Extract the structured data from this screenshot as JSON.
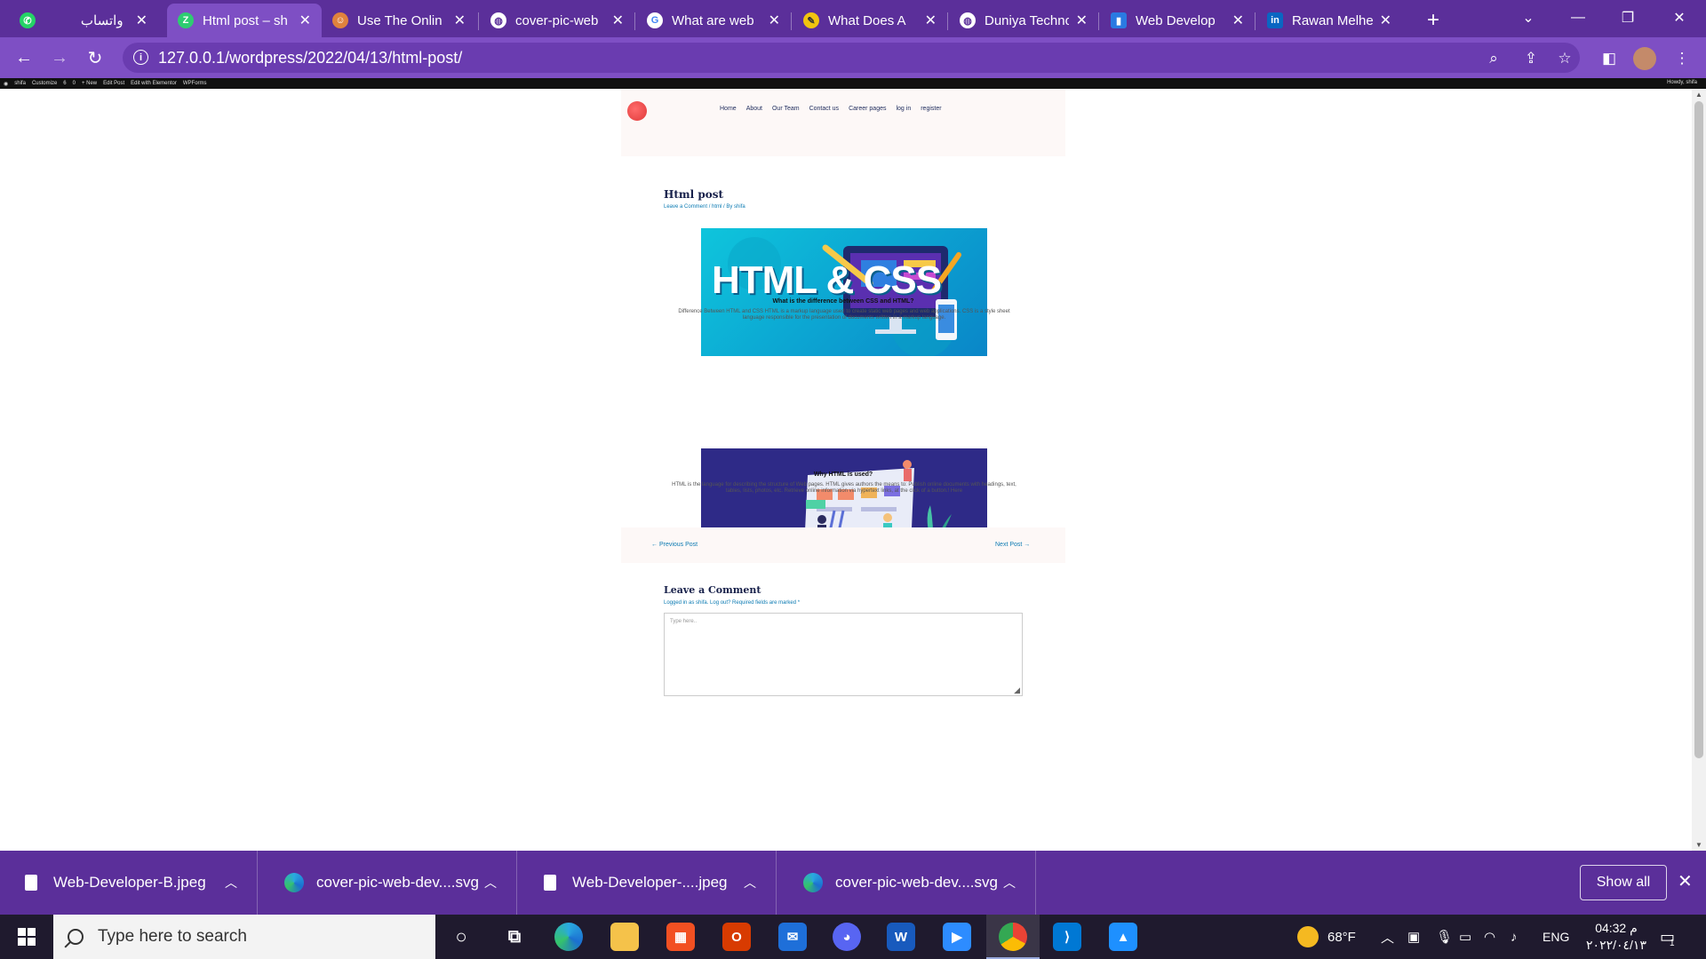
{
  "browser": {
    "tabs": [
      {
        "title": "واتساب",
        "favicon": "whatsapp-icon",
        "color": "#25d366"
      },
      {
        "title": "Html post – sh",
        "favicon": "site-icon",
        "color": "#2ecc71",
        "active": true
      },
      {
        "title": "Use The Onlin",
        "favicon": "person-icon",
        "color": "#e0823d"
      },
      {
        "title": "cover-pic-web",
        "favicon": "globe-icon",
        "color": "#ffffff"
      },
      {
        "title": "What are web",
        "favicon": "google-icon",
        "color": "#ffffff"
      },
      {
        "title": "What Does A",
        "favicon": "pen-icon",
        "color": "#f1c40f"
      },
      {
        "title": "Duniya Techno",
        "favicon": "globe-icon",
        "color": "#ffffff"
      },
      {
        "title": "Web Develop",
        "favicon": "bookmark-icon",
        "color": "#2a7ae2"
      },
      {
        "title": "Rawan Melhe",
        "favicon": "linkedin-icon",
        "color": "#0a66c2"
      }
    ],
    "new_tab": "+",
    "url": "127.0.0.1/wordpress/2022/04/13/html-post/"
  },
  "wp_admin_bar": {
    "items": [
      "shifa",
      "Customize",
      "6",
      "0",
      "+ New",
      "Edit Post",
      "Edit with Elementor",
      "WPForms"
    ],
    "greeting": "Howdy, shifa"
  },
  "site": {
    "menu": [
      "Home",
      "About",
      "Our Team",
      "Contact us",
      "Career pages",
      "log in",
      "register"
    ],
    "post_title": "Html post",
    "post_meta": "Leave a Comment / html / By shifa",
    "section1_heading": "What is the difference between CSS and HTML?",
    "section1_text": "Difference Between HTML and CSS HTML is a markup language used to create static web pages and web applications. CSS is a style sheet language responsible for the presentation of documents written in a markup language.",
    "hero1_text": "HTML & CSS",
    "section2_heading": "Why HTML is used?",
    "section2_text": "HTML is the language for describing the structure of Web pages. HTML gives authors the means to: Publish online documents with headings, text, tables, lists, photos, etc. Retrieve online information via hypertext links, at the click of a button.! Here",
    "prev_post": "← Previous Post",
    "next_post": "Next Post →",
    "comment_title": "Leave a Comment",
    "comment_note": "Logged in as shifa. Log out? Required fields are marked *",
    "comment_placeholder": "Type here.."
  },
  "downloads": {
    "items": [
      {
        "name": "Web-Developer-B.jpeg",
        "icon": "file-icon"
      },
      {
        "name": "cover-pic-web-dev....svg",
        "icon": "edge-icon"
      },
      {
        "name": "Web-Developer-....jpeg",
        "icon": "file-icon"
      },
      {
        "name": "cover-pic-web-dev....svg",
        "icon": "edge-icon"
      }
    ],
    "show_all": "Show all"
  },
  "taskbar": {
    "search_placeholder": "Type here to search",
    "weather": "68°F",
    "language": "ENG",
    "time": "04:32 م",
    "date": "٢٠٢٢/٠٤/١٣",
    "notification_count": "1"
  }
}
